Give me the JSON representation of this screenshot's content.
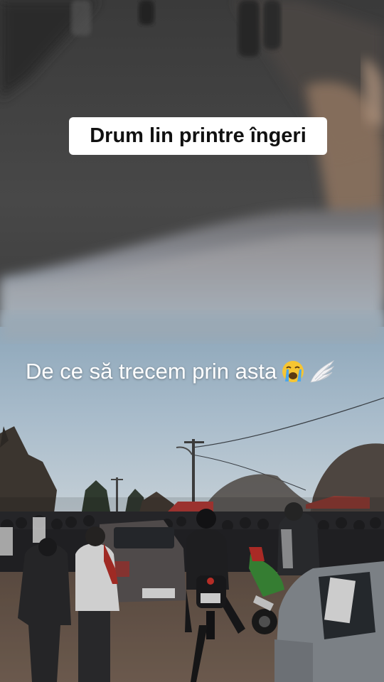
{
  "overlay": {
    "top_caption": "Drum lin printre îngeri",
    "middle_caption": "De ce să trecem prin asta",
    "middle_emojis": [
      "crying-face-icon",
      "wing-icon"
    ]
  },
  "colors": {
    "caption_box": "#ffffff",
    "caption_text": "#111111",
    "overlay_text": "#ffffff",
    "sky": "#9fb6c8"
  }
}
